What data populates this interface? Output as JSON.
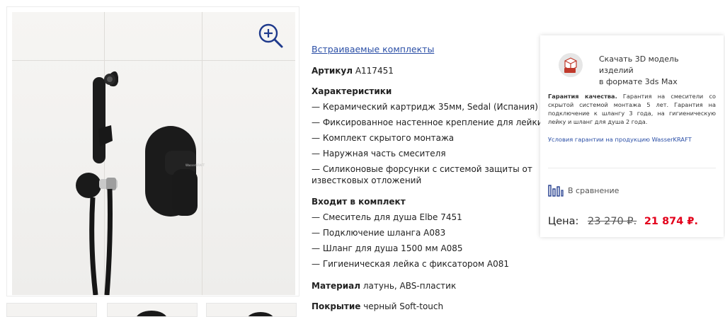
{
  "product": {
    "category_link": "Встраиваемые комплекты",
    "article_label": "Артикул",
    "article_value": "A117451",
    "characteristics_title": "Характеристики",
    "characteristics": [
      "— Керамический картридж 35мм, Sedal (Испания)",
      "— Фиксированное настенное крепление для лейки",
      "— Комплект скрытого монтажа",
      "— Наружная часть смесителя",
      "— Силиконовые форсунки с системой защиты от",
      "известковых отложений"
    ],
    "kit_title": "Входит в комплект",
    "kit_items": [
      "— Смеситель для душа Elbe 7451",
      "— Подключение шланга A083",
      "— Шланг для душа 1500 мм A085",
      "— Гигиеническая лейка с фиксатором A081"
    ],
    "material_label": "Материал",
    "material_value": "латунь, ABS-пластик",
    "coating_label": "Покрытие",
    "coating_value": "черный Soft-touch"
  },
  "sidebar": {
    "download_line1": "Скачать 3D модель изделий",
    "download_line2": "в формате 3ds Max",
    "download_icon": "3ds-max-file-icon",
    "guarantee_bold": "Гарантия качества.",
    "guarantee_text": "Гарантия на смесители со скрытой системой монтажа 5 лет. Гарантия на подключение к шлангу 3 года, на гигиеническую лейку и шланг для душа 2 года.",
    "guarantee_link": "Условия гарантии на продукцию WasserKRAFT",
    "compare_label": "В сравнение",
    "price_label": "Цена:",
    "old_price": "23 270 ₽.",
    "new_price": "21 874 ₽."
  },
  "gallery": {
    "zoom_icon": "zoom-in-icon",
    "mixer_brand": "WasserKRAFT"
  },
  "colors": {
    "link": "#2b4fa6",
    "price_new": "#e3001b",
    "zoom_icon": "#1f3a8c"
  }
}
